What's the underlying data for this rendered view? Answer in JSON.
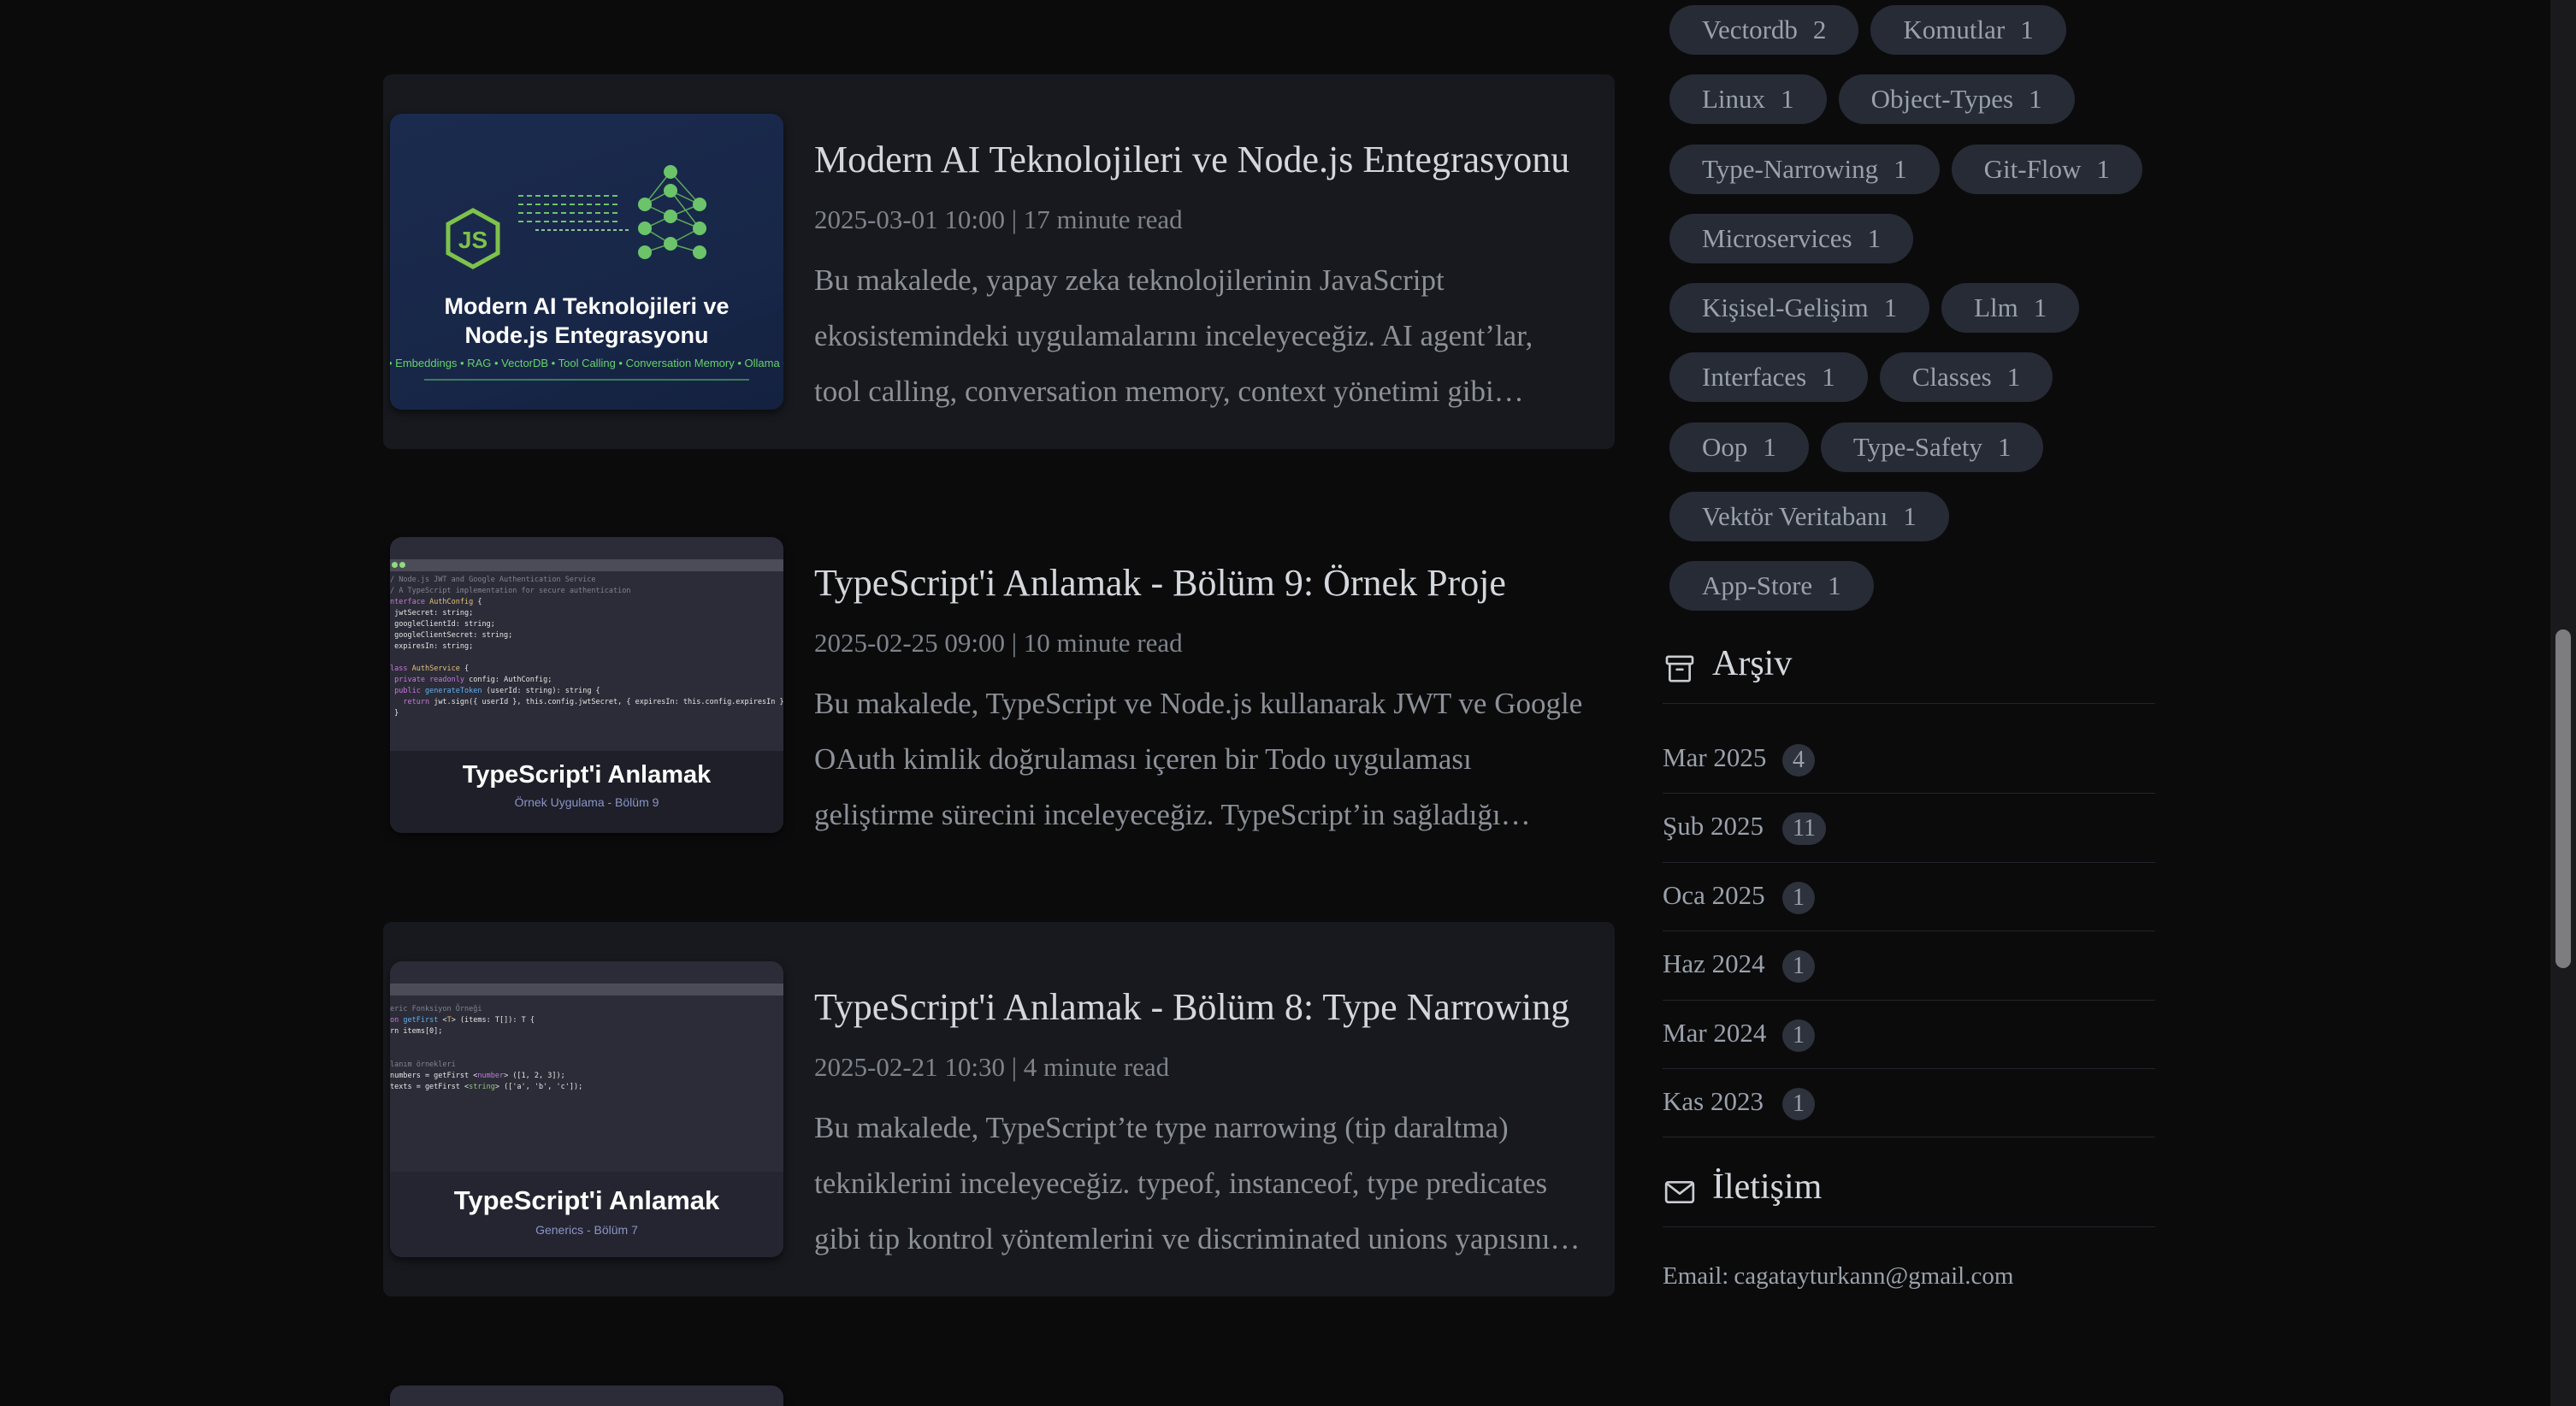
{
  "posts": [
    {
      "title": "Modern AI Teknolojileri ve Node.js Entegrasyonu",
      "meta": "2025-03-01 10:00 | 17 minute read",
      "excerpt": "Bu makalede, yapay zeka teknolojilerinin JavaScript ekosistemindeki uygulamalarını inceleyeceğiz. AI agent’lar, tool calling, conversation memory, context yönetimi gibi konuları ele alacağız.",
      "thumb": {
        "title_line1": "Modern AI Teknolojileri ve",
        "title_line2": "Node.js Entegrasyonu",
        "tags": "• Embeddings • RAG • VectorDB • Tool Calling • Conversation Memory • Ollama • LiteLLM"
      }
    },
    {
      "title": "TypeScript'i Anlamak - Bölüm 9: Örnek Proje",
      "meta": "2025-02-25 09:00 | 10 minute read",
      "excerpt": "Bu makalede, TypeScript ve Node.js kullanarak JWT ve Google OAuth kimlik doğrulaması içeren bir Todo uygulaması geliştirme sürecini inceleyeceğiz. TypeScript’in sağladığı avantajları göreceğiz.",
      "thumb": {
        "title": "TypeScript'i Anlamak",
        "subtitle": "Örnek Uygulama - Bölüm 9"
      }
    },
    {
      "title": "TypeScript'i Anlamak - Bölüm 8: Type Narrowing",
      "meta": "2025-02-21 10:30 | 4 minute read",
      "excerpt": "Bu makalede, TypeScript’te type narrowing (tip daraltma) tekniklerini inceleyeceğiz. typeof, instanceof, type predicates gibi tip kontrol yöntemlerini ve discriminated unions yapısını öğreneceğiz.",
      "thumb": {
        "title": "TypeScript'i Anlamak",
        "subtitle": "Generics - Bölüm 7"
      }
    }
  ],
  "tags": [
    [
      {
        "name": "Vectordb",
        "count": "2"
      },
      {
        "name": "Komutlar",
        "count": "1"
      }
    ],
    [
      {
        "name": "Linux",
        "count": "1"
      },
      {
        "name": "Object-Types",
        "count": "1"
      }
    ],
    [
      {
        "name": "Type-Narrowing",
        "count": "1"
      },
      {
        "name": "Git-Flow",
        "count": "1"
      }
    ],
    [
      {
        "name": "Microservices",
        "count": "1"
      }
    ],
    [
      {
        "name": "Kişisel-Gelişim",
        "count": "1"
      },
      {
        "name": "Llm",
        "count": "1"
      }
    ],
    [
      {
        "name": "Interfaces",
        "count": "1"
      },
      {
        "name": "Classes",
        "count": "1"
      }
    ],
    [
      {
        "name": "Oop",
        "count": "1"
      },
      {
        "name": "Type-Safety",
        "count": "1"
      }
    ],
    [
      {
        "name": "Vektör Veritabanı",
        "count": "1"
      }
    ],
    [
      {
        "name": "App-Store",
        "count": "1"
      }
    ]
  ],
  "archive": {
    "heading": "Arşiv",
    "icon": "archive-icon",
    "items": [
      {
        "label": "Mar 2025",
        "count": "4"
      },
      {
        "label": "Şub 2025",
        "count": "11"
      },
      {
        "label": "Oca 2025",
        "count": "1"
      },
      {
        "label": "Haz 2024",
        "count": "1"
      },
      {
        "label": "Mar 2024",
        "count": "1"
      },
      {
        "label": "Kas 2023",
        "count": "1"
      }
    ]
  },
  "contact": {
    "heading": "İletişim",
    "icon": "mail-icon",
    "email_label": "Email:",
    "email": "cagatayturkann@gmail.com"
  },
  "colors": {
    "background": "#0b0b0c",
    "card": "#17191e",
    "tag_bg": "#262b35",
    "node_green": "#68a063"
  }
}
